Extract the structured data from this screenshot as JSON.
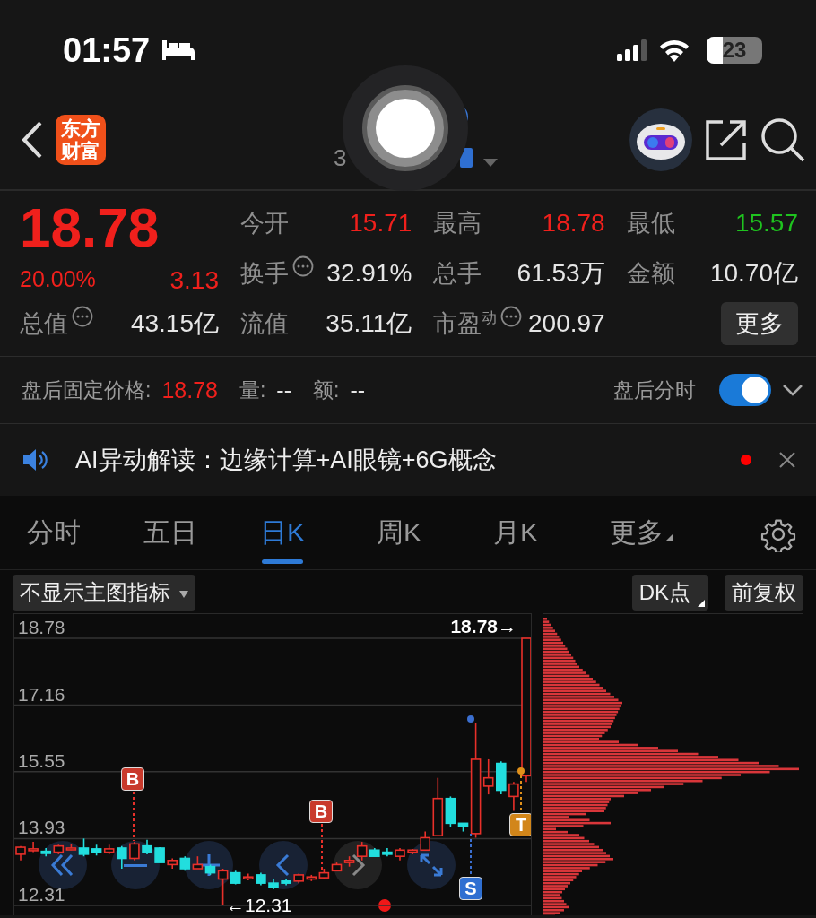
{
  "status_bar": {
    "time": "01:57",
    "battery": "23"
  },
  "nav": {
    "logo": "东方财富",
    "code_visible": "3"
  },
  "quote": {
    "price": "18.78",
    "change_pct": "20.00%",
    "change": "3.13",
    "color": "#f0201c",
    "fields": [
      {
        "label": "今开",
        "value": "15.71",
        "color": "#f0201c",
        "info": false
      },
      {
        "label": "最高",
        "value": "18.78",
        "color": "#f0201c",
        "info": false
      },
      {
        "label": "最低",
        "value": "15.57",
        "color": "#1fc31f",
        "info": false
      },
      {
        "label": "换手",
        "value": "32.91%",
        "color": "#e6e6e6",
        "info": true
      },
      {
        "label": "总手",
        "value": "61.53万",
        "color": "#e6e6e6",
        "info": false
      },
      {
        "label": "金额",
        "value": "10.70亿",
        "color": "#e6e6e6",
        "info": false
      },
      {
        "label": "总值",
        "value": "43.15亿",
        "color": "#e6e6e6",
        "info": true
      },
      {
        "label": "流值",
        "value": "35.11亿",
        "color": "#e6e6e6",
        "info": false
      },
      {
        "label": "市盈$^{动}$",
        "value": "200.97",
        "color": "#e6e6e6",
        "info": true
      }
    ],
    "more_button": "更多"
  },
  "after_hours": {
    "label": "盘后固定价格:",
    "price": "18.78",
    "volume_label": "量:",
    "volume": "--",
    "amount_label": "额:",
    "amount": "--",
    "toggle_label": "盘后分时",
    "toggle_on": true
  },
  "ai_banner": {
    "text": "AI异动解读：边缘计算+AI眼镜+6G概念",
    "unread": true
  },
  "tabs": [
    {
      "label": "分时",
      "selected": false,
      "menu": false
    },
    {
      "label": "五日",
      "selected": false,
      "menu": false
    },
    {
      "label": "日K",
      "selected": true,
      "menu": false
    },
    {
      "label": "周K",
      "selected": false,
      "menu": false
    },
    {
      "label": "月K",
      "selected": false,
      "menu": false
    },
    {
      "label": "更多",
      "selected": false,
      "menu": true
    }
  ],
  "toolbar": {
    "indicator": "不显示主图指标",
    "dk": "DK点",
    "adjust": "前复权"
  },
  "chart": {
    "high_label": "18.78→",
    "low_label": "←12.31",
    "markers": [
      {
        "label": "B",
        "kind": "buy"
      },
      {
        "label": "B",
        "kind": "buy"
      },
      {
        "label": "S",
        "kind": "sell"
      },
      {
        "label": "T",
        "kind": "t"
      }
    ],
    "chart_data": {
      "type": "candlestick",
      "grid": true,
      "ylim": [
        12.31,
        18.78
      ],
      "yticks": [
        {
          "value": 12.31,
          "label": "12.31"
        },
        {
          "value": 13.93,
          "label": "13.93"
        },
        {
          "value": 15.55,
          "label": "15.55"
        },
        {
          "value": 17.16,
          "label": "17.16"
        },
        {
          "value": 18.78,
          "label": "18.78"
        }
      ],
      "ohlc": [
        [
          13.55,
          13.75,
          13.4,
          13.72
        ],
        [
          13.64,
          13.85,
          13.6,
          13.68
        ],
        [
          13.62,
          13.7,
          13.5,
          13.57
        ],
        [
          13.6,
          13.78,
          13.55,
          13.75
        ],
        [
          13.68,
          13.8,
          13.65,
          13.7
        ],
        [
          13.7,
          13.93,
          13.5,
          13.55
        ],
        [
          13.68,
          13.78,
          13.52,
          13.6
        ],
        [
          13.6,
          13.78,
          13.55,
          13.68
        ],
        [
          13.7,
          13.75,
          13.2,
          13.45
        ],
        [
          13.45,
          13.85,
          13.4,
          13.8
        ],
        [
          13.75,
          13.9,
          13.55,
          13.6
        ],
        [
          13.7,
          13.72,
          13.35,
          13.35
        ],
        [
          13.3,
          13.45,
          13.2,
          13.4
        ],
        [
          13.45,
          13.5,
          13.15,
          13.2
        ],
        [
          13.2,
          13.5,
          13.2,
          13.3
        ],
        [
          13.25,
          13.3,
          13.05,
          13.1
        ],
        [
          12.95,
          13.2,
          12.31,
          13.15
        ],
        [
          13.1,
          13.15,
          12.82,
          12.85
        ],
        [
          12.98,
          13.08,
          12.92,
          13.0
        ],
        [
          13.05,
          13.1,
          12.8,
          12.85
        ],
        [
          12.85,
          12.95,
          12.7,
          12.75
        ],
        [
          12.9,
          12.95,
          12.8,
          12.85
        ],
        [
          12.9,
          13.08,
          12.85,
          13.05
        ],
        [
          12.95,
          13.05,
          12.9,
          13.0
        ],
        [
          12.98,
          13.2,
          12.95,
          13.1
        ],
        [
          13.15,
          13.35,
          13.15,
          13.3
        ],
        [
          13.35,
          13.5,
          13.25,
          13.4
        ],
        [
          13.5,
          13.85,
          13.4,
          13.75
        ],
        [
          13.65,
          13.7,
          13.5,
          13.5
        ],
        [
          13.6,
          13.7,
          13.5,
          13.55
        ],
        [
          13.5,
          13.7,
          13.4,
          13.65
        ],
        [
          13.6,
          13.68,
          13.55,
          13.65
        ],
        [
          13.65,
          14.1,
          13.65,
          13.95
        ],
        [
          14.0,
          15.4,
          14.0,
          14.9
        ],
        [
          14.9,
          14.95,
          14.2,
          14.3
        ],
        [
          14.3,
          14.3,
          14.1,
          14.22
        ],
        [
          14.05,
          16.73,
          13.95,
          15.85
        ],
        [
          15.2,
          15.85,
          15.0,
          15.4
        ],
        [
          15.75,
          15.8,
          15.0,
          15.1
        ],
        [
          14.95,
          15.3,
          14.6,
          15.25
        ],
        [
          15.45,
          18.78,
          15.3,
          18.78
        ]
      ]
    }
  }
}
